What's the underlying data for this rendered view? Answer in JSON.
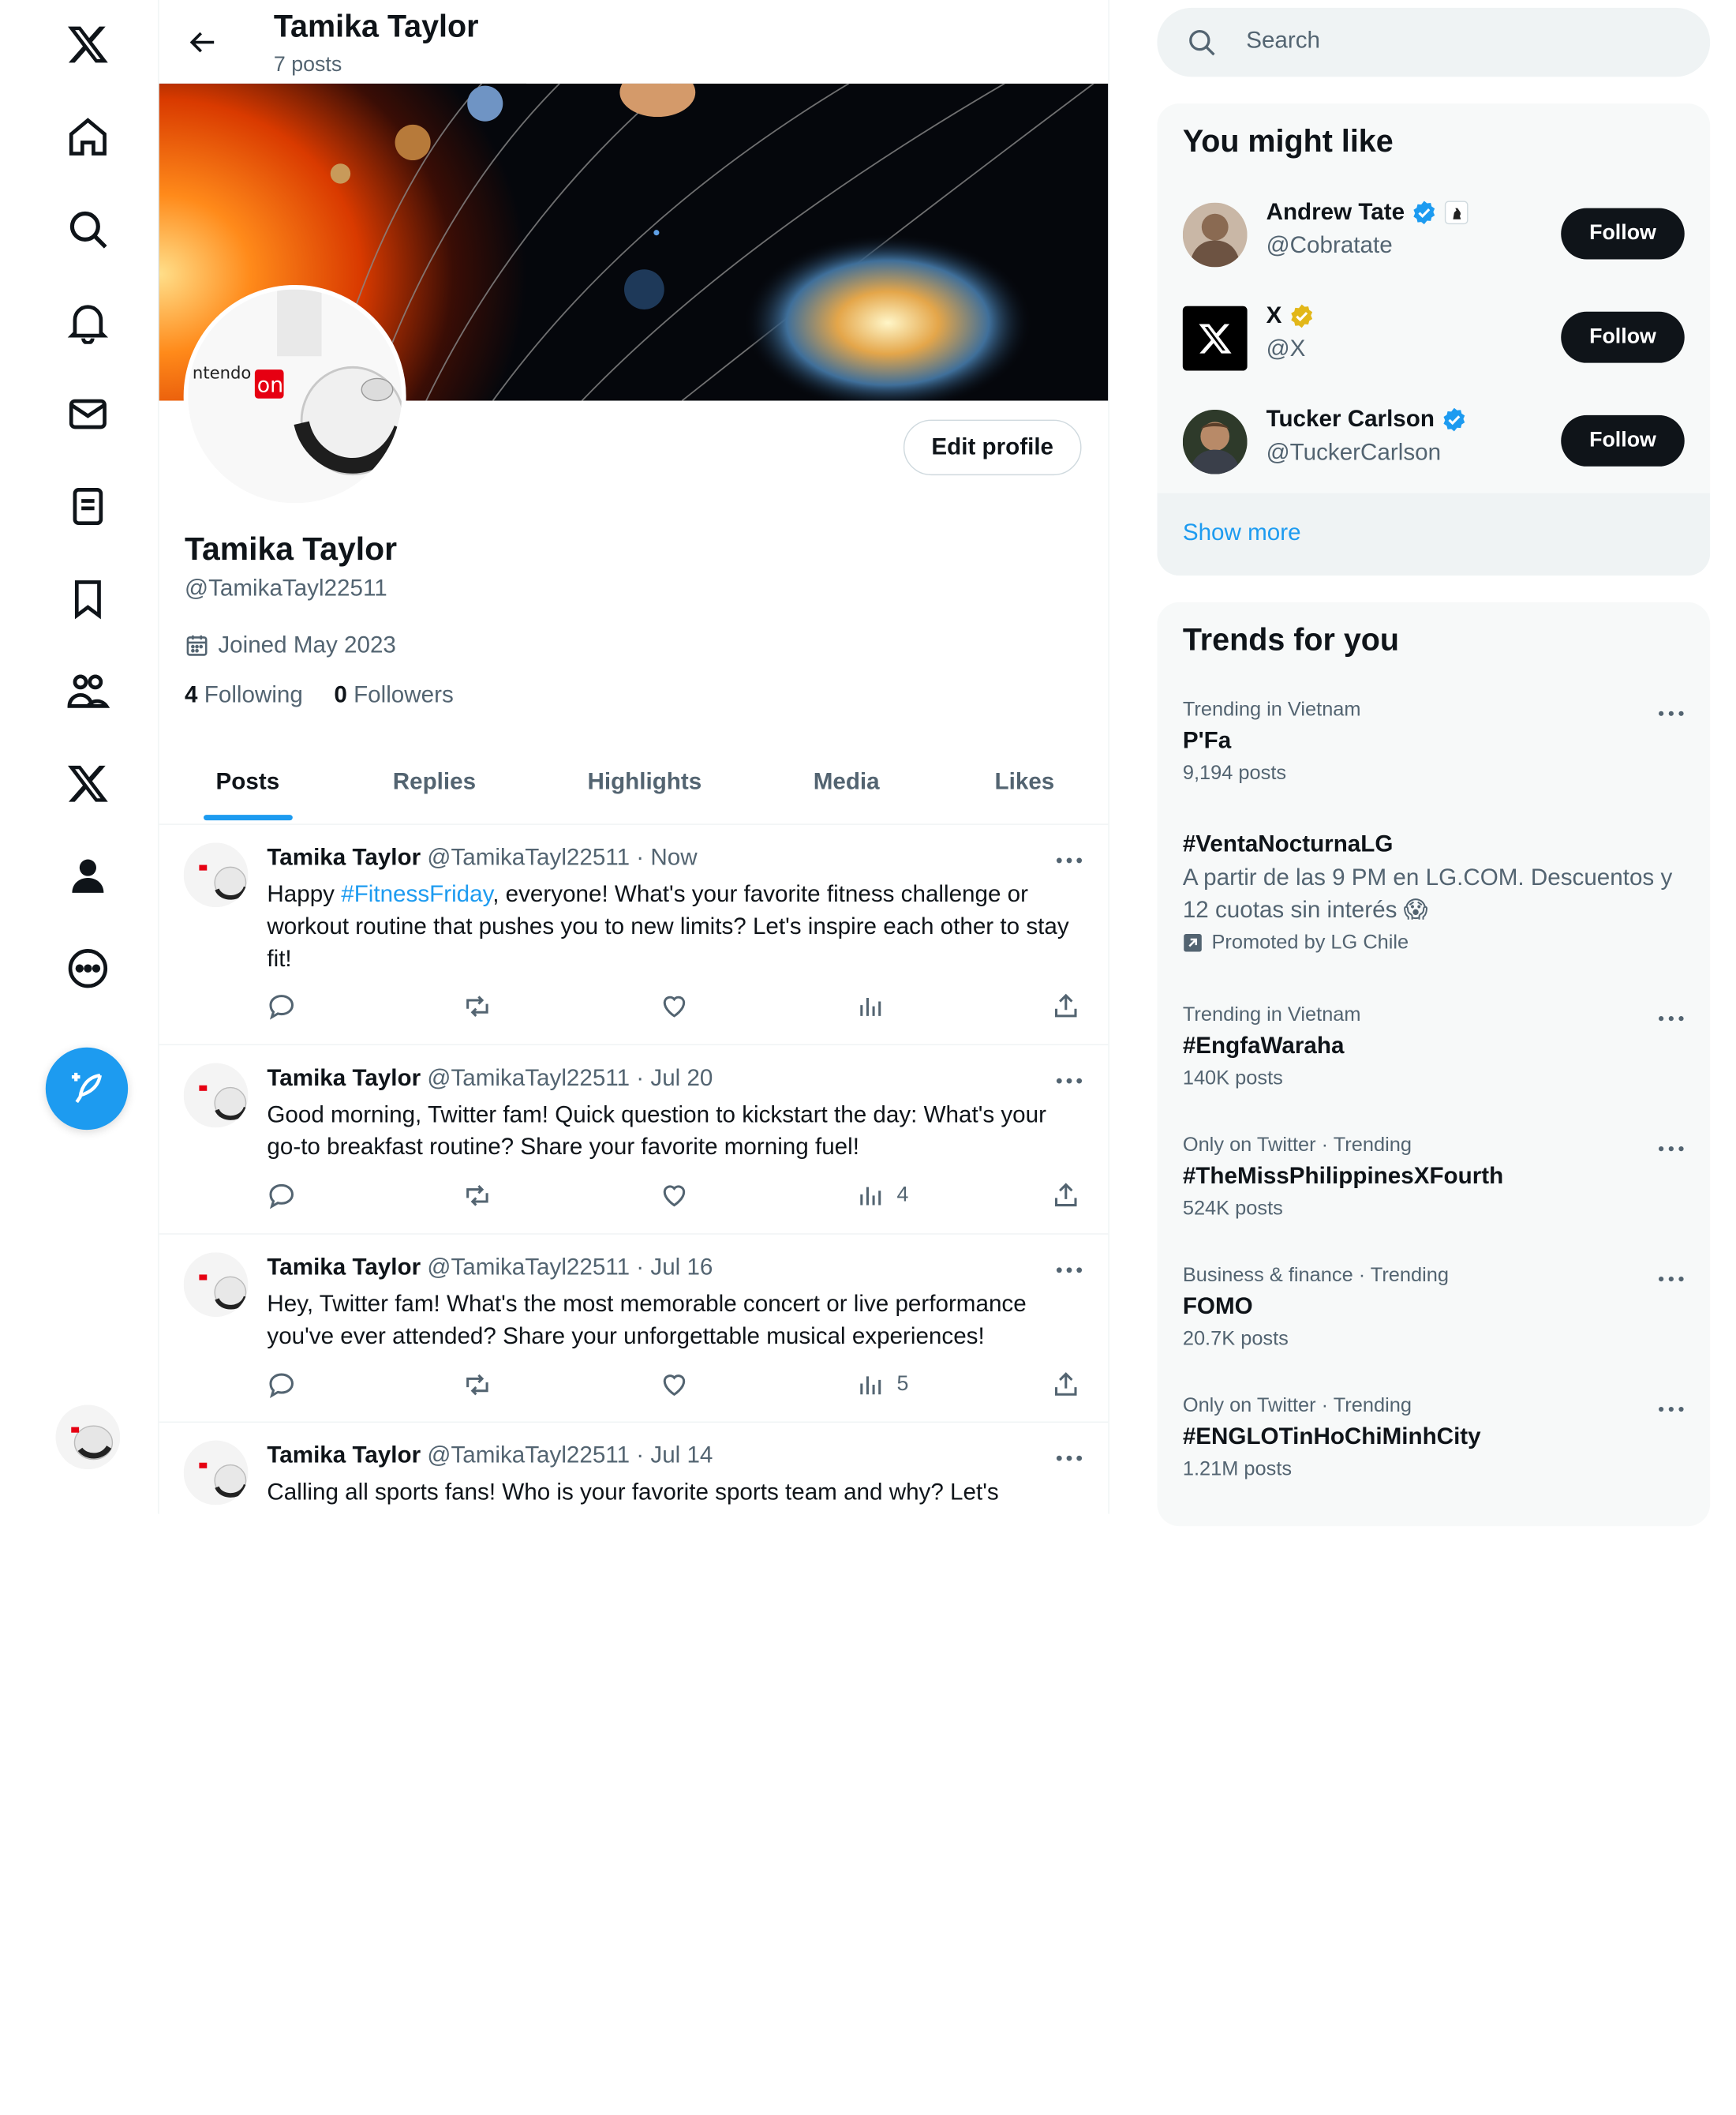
{
  "colors": {
    "accent": "#1d9bf0",
    "text": "#0f1419",
    "muted": "#536471",
    "gold": "#e2b719"
  },
  "nav": {
    "items": [
      {
        "name": "x-logo-icon"
      },
      {
        "name": "home-icon"
      },
      {
        "name": "explore-icon"
      },
      {
        "name": "notifications-icon"
      },
      {
        "name": "messages-icon"
      },
      {
        "name": "lists-icon"
      },
      {
        "name": "bookmarks-icon"
      },
      {
        "name": "communities-icon"
      },
      {
        "name": "premium-icon"
      },
      {
        "name": "profile-icon"
      },
      {
        "name": "more-icon"
      }
    ],
    "compose_icon": "feather-plus-icon"
  },
  "header": {
    "name": "Tamika Taylor",
    "posts_count": "7 posts"
  },
  "profile": {
    "name": "Tamika Taylor",
    "handle": "@TamikaTayl22511",
    "joined": "Joined May 2023",
    "following_count": "4",
    "following_label": "Following",
    "followers_count": "0",
    "followers_label": "Followers",
    "edit_label": "Edit profile",
    "avatar_text": "ntendo",
    "avatar_badge": "on"
  },
  "tabs": [
    "Posts",
    "Replies",
    "Highlights",
    "Media",
    "Likes"
  ],
  "posts": [
    {
      "name": "Tamika Taylor",
      "handle": "@TamikaTayl22511",
      "time": "Now",
      "text_before": "Happy ",
      "hashtag": "#FitnessFriday",
      "text_after": ", everyone! What's your favorite fitness challenge or workout routine that pushes you to new limits? Let's inspire each other to stay fit!",
      "views": ""
    },
    {
      "name": "Tamika Taylor",
      "handle": "@TamikaTayl22511",
      "time": "Jul 20",
      "text_before": "Good morning, Twitter fam! Quick question to kickstart the day: What's your go-to breakfast routine? Share your favorite morning fuel!",
      "hashtag": "",
      "text_after": "",
      "views": "4"
    },
    {
      "name": "Tamika Taylor",
      "handle": "@TamikaTayl22511",
      "time": "Jul 16",
      "text_before": "Hey, Twitter fam! What's the most memorable concert or live performance you've ever attended? Share your unforgettable musical experiences!",
      "hashtag": "",
      "text_after": "",
      "views": "5"
    },
    {
      "name": "Tamika Taylor",
      "handle": "@TamikaTayl22511",
      "time": "Jul 14",
      "text_before": "Calling all sports fans! Who is your favorite sports team and why? Let's",
      "hashtag": "",
      "text_after": "",
      "views": ""
    }
  ],
  "search": {
    "placeholder": "Search"
  },
  "suggestions": {
    "title": "You might like",
    "follow_label": "Follow",
    "show_more": "Show more",
    "users": [
      {
        "name": "Andrew Tate",
        "handle": "@Cobratate",
        "badge": "blue"
      },
      {
        "name": "X",
        "handle": "@X",
        "badge": "gold"
      },
      {
        "name": "Tucker Carlson",
        "handle": "@TuckerCarlson",
        "badge": "blue"
      }
    ]
  },
  "trends": {
    "title": "Trends for you",
    "items": [
      {
        "context": "Trending in Vietnam",
        "name": "P'Fa",
        "count": "9,194 posts"
      },
      {
        "context": "",
        "name": "#VentaNocturnaLG",
        "desc": "A partir de las 9 PM en LG.COM. Descuentos y 12 cuotas sin interés 😱",
        "promoted": "Promoted by LG Chile"
      },
      {
        "context": "Trending in Vietnam",
        "name": "#EngfaWaraha",
        "count": "140K posts"
      },
      {
        "context": "Only on Twitter · Trending",
        "name": "#TheMissPhilippinesXFourth",
        "count": "524K posts"
      },
      {
        "context": "Business & finance · Trending",
        "name": "FOMO",
        "count": "20.7K posts"
      },
      {
        "context": "Only on Twitter · Trending",
        "name": "#ENGLOTinHoChiMinhCity",
        "count": "1.21M posts"
      }
    ]
  }
}
